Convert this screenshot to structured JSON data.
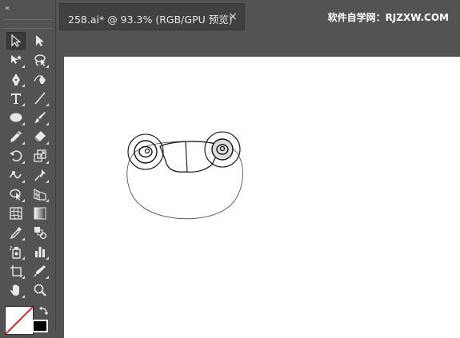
{
  "toolbar": {
    "collapse_glyph": "«",
    "tools": [
      {
        "icon": "selection-arrow-icon",
        "selected": true
      },
      {
        "icon": "direct-selection-icon"
      },
      {
        "icon": "magic-wand-icon"
      },
      {
        "icon": "lasso-icon"
      },
      {
        "icon": "pen-icon"
      },
      {
        "icon": "curvature-icon"
      },
      {
        "icon": "type-icon",
        "glyph": "T"
      },
      {
        "icon": "line-segment-icon"
      },
      {
        "icon": "ellipse-icon"
      },
      {
        "icon": "paintbrush-icon"
      },
      {
        "icon": "pencil-icon"
      },
      {
        "icon": "eraser-icon"
      },
      {
        "icon": "rotate-icon"
      },
      {
        "icon": "scale-icon"
      },
      {
        "icon": "warp-icon"
      },
      {
        "icon": "puppet-warp-icon"
      },
      {
        "icon": "shape-builder-icon"
      },
      {
        "icon": "perspective-grid-icon"
      },
      {
        "icon": "mesh-icon"
      },
      {
        "icon": "gradient-icon"
      },
      {
        "icon": "eyedropper-icon"
      },
      {
        "icon": "blend-icon"
      },
      {
        "icon": "symbol-sprayer-icon"
      },
      {
        "icon": "column-graph-icon"
      },
      {
        "icon": "artboard-icon"
      },
      {
        "icon": "slice-icon"
      },
      {
        "icon": "hand-icon"
      },
      {
        "icon": "zoom-icon"
      }
    ]
  },
  "document_tab": {
    "title": "258.ai* @ 93.3% (RGB/GPU 预览)",
    "close_glyph": "×"
  },
  "watermark": "软件自学网：RJZXW.COM",
  "colors": {
    "ui_background": "#535353",
    "tab_background": "#414141",
    "artboard": "#ffffff",
    "fill_swatch": "#ffffff",
    "stroke_swatch": "#000000",
    "none_slash": "#e02020"
  }
}
